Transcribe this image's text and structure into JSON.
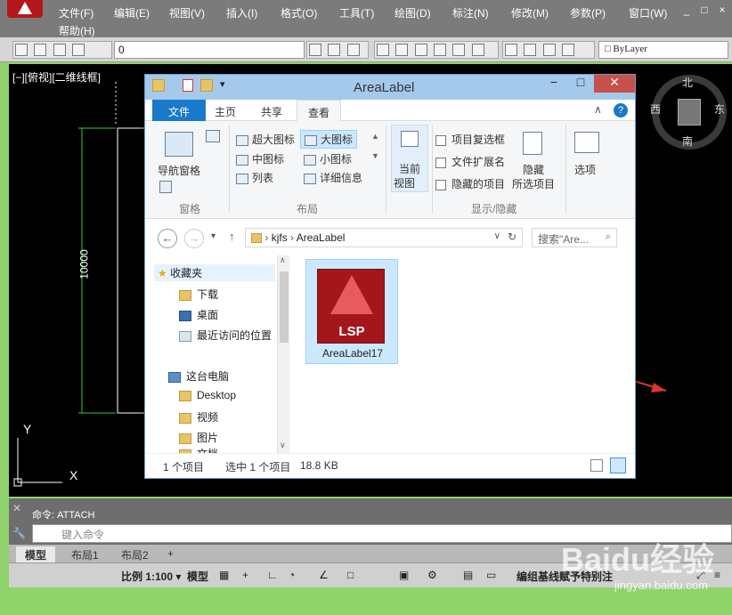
{
  "menu": {
    "items": [
      "编辑(E)",
      "视图(V)",
      "插入(I)",
      "格式(O)",
      "工具(T)",
      "绘图(D)",
      "标注(N)",
      "修改(M)",
      "参数(P)",
      "窗口(W)"
    ],
    "first": "文件(F)",
    "help": "帮助(H)",
    "win_controls": [
      "_",
      "□",
      "×"
    ]
  },
  "toolbar": {
    "layer_value": "0",
    "color_value": "ByLayer"
  },
  "drawing": {
    "view_label": "[−][俯视][二维线框]",
    "dimension": "10000",
    "axis_y": "Y",
    "axis_x": "X",
    "compass": {
      "north": "北",
      "south": "南",
      "east": "东",
      "west": "西"
    }
  },
  "command": {
    "last": "命令: ATTACH",
    "placeholder": "键入命令"
  },
  "layout_tabs": [
    "模型",
    "布局1",
    "布局2",
    "+"
  ],
  "statusbar_items": [
    "比例 1:100 ▾",
    "模型",
    "编组基线赋予特别注"
  ],
  "explorer": {
    "title": "AreaLabel",
    "tabs": [
      "文件",
      "主页",
      "共享",
      "查看"
    ],
    "ribbon": {
      "nav_pane": "导航窗格",
      "pane_group": "窗格",
      "layouts": [
        "超大图标",
        "大图标",
        "中图标",
        "小图标",
        "列表",
        "详细信息"
      ],
      "layout_group": "布局",
      "current_view": [
        "当前",
        "视图"
      ],
      "checks": [
        "项目复选框",
        "文件扩展名",
        "隐藏的项目"
      ],
      "hide_selected": [
        "隐藏",
        "所选项目"
      ],
      "options": "选项",
      "show_group": "显示/隐藏"
    },
    "address": {
      "parts": [
        "kjfs",
        "AreaLabel"
      ],
      "search_placeholder": "搜索\"Are..."
    },
    "nav_pane": {
      "favorites": "收藏夹",
      "fav_items": [
        "下载",
        "桌面",
        "最近访问的位置"
      ],
      "pc": "这台电脑",
      "pc_items": [
        "Desktop",
        "视频",
        "图片",
        "文档"
      ]
    },
    "file": {
      "name": "AreaLabel17",
      "icon_text": "LSP"
    },
    "status": {
      "count": "1 个项目",
      "selected": "选中 1 个项目",
      "size": "18.8 KB"
    }
  },
  "watermark": {
    "brand": "Baidu经验",
    "url": "jingyan.baidu.com"
  },
  "colors": {
    "accent_red": "#d9352f",
    "file_blue": "#1979ca",
    "dim_green": "#2fd12f"
  }
}
